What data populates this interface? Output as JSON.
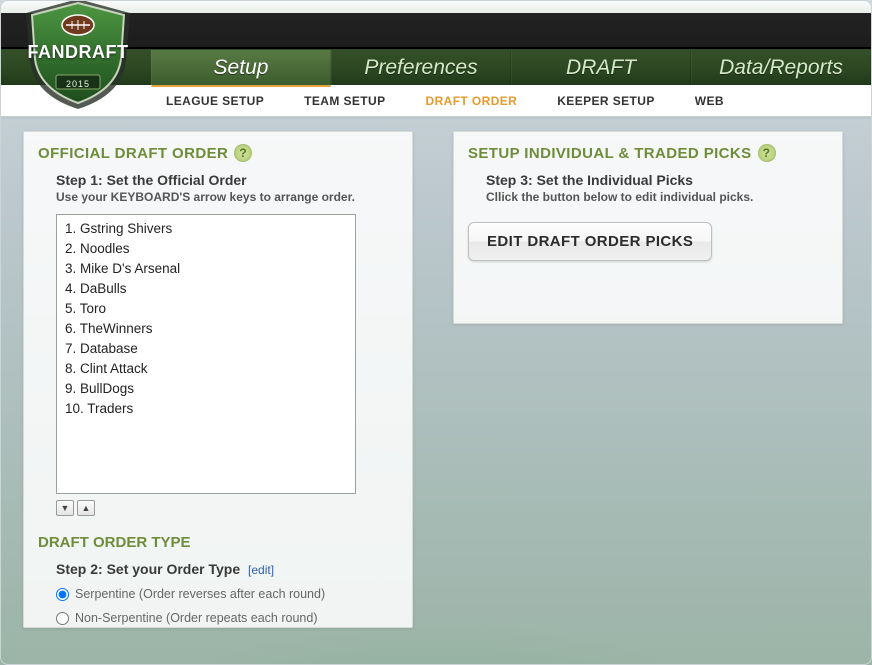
{
  "logo": {
    "brand": "FANDRAFT",
    "year": "2015"
  },
  "mainNav": {
    "tabs": [
      {
        "label": "Setup",
        "active": true
      },
      {
        "label": "Preferences",
        "active": false
      },
      {
        "label": "DRAFT",
        "active": false
      },
      {
        "label": "Data/Reports",
        "active": false
      }
    ]
  },
  "subNav": {
    "tabs": [
      {
        "label": "LEAGUE SETUP",
        "active": false
      },
      {
        "label": "TEAM SETUP",
        "active": false
      },
      {
        "label": "DRAFT ORDER",
        "active": true
      },
      {
        "label": "KEEPER SETUP",
        "active": false
      },
      {
        "label": "WEB",
        "active": false
      }
    ]
  },
  "leftPanel": {
    "title": "OFFICIAL DRAFT ORDER",
    "helpGlyph": "?",
    "step1Title": "Step 1: Set the Official Order",
    "step1Hint": "Use your KEYBOARD'S arrow keys to arrange order.",
    "teams": [
      "Gstring Shivers",
      "Noodles",
      "Mike D's Arsenal",
      "DaBulls",
      "Toro",
      "TheWinners",
      "Database",
      "Clint Attack",
      "BullDogs",
      "Traders"
    ],
    "orderTypeTitle": "DRAFT ORDER TYPE",
    "step2Title": "Step 2: Set your Order Type",
    "editLink": "[edit]",
    "radios": {
      "serpentine": "Serpentine (Order reverses after each round)",
      "nonSerpentine": "Non-Serpentine (Order repeats each round)"
    }
  },
  "rightPanel": {
    "title": "SETUP INDIVIDUAL & TRADED PICKS",
    "helpGlyph": "?",
    "step3Title": "Step 3: Set the Individual Picks",
    "step3Hint": "Cllick the button below to edit individual picks.",
    "editButton": "EDIT DRAFT ORDER PICKS"
  }
}
